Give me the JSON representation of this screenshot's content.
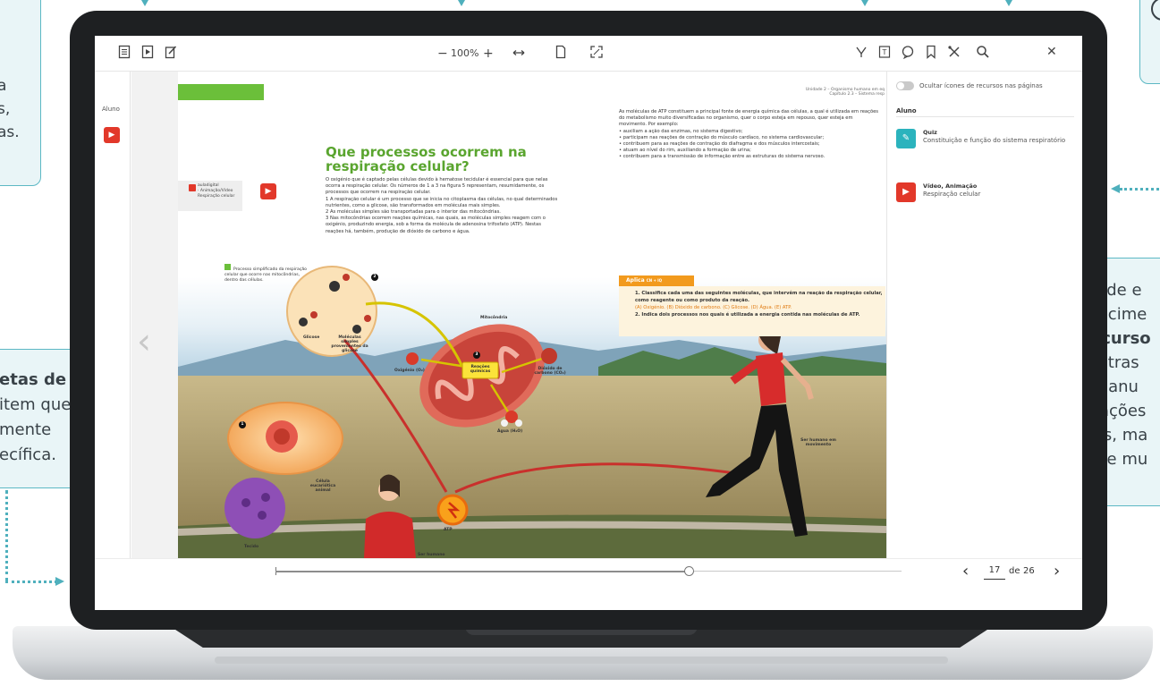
{
  "callouts": {
    "top_left": [
      "a",
      "s,",
      "as."
    ],
    "mid_left": [
      "etas de",
      "item que",
      "mente",
      "ecífica."
    ],
    "mid_left_bold_line": "etas de",
    "right": [
      "Aprende e",
      "conhecime",
      "os recurso",
      "encontras",
      "dos manu",
      "animações",
      "áudios, ma",
      "jogos e mu"
    ],
    "right_bold_word": "recurso"
  },
  "toolbar": {
    "zoom_minus": "−",
    "zoom_value": "100%",
    "zoom_plus": "+",
    "close": "✕"
  },
  "rail": {
    "label": "Aluno"
  },
  "page_content": {
    "left_title": "Que processos ocorrem na respiração celular?",
    "left_body": [
      "O oxigénio que é captado pelas células devido à hematose tecidular é essencial para que nelas ocorra a respiração celular. Os números de 1 a 3 na figura 5 representam, resumidamente, os processos que ocorrem na respiração celular.",
      "1  A respiração celular é um processo que se inicia no citoplasma das células, no qual determinados nutrientes, como a glicose, são transformados em moléculas mais simples.",
      "2  As moléculas simples são transportadas para o interior das mitocôndrias.",
      "3  Nas mitocôndrias ocorrem reações químicas, nas quais, as moléculas simples reagem com o oxigénio, produzindo energia, sob a forma da molécula de adenosina trifosfato (ATP). Nestas reações há, também, produção de dióxido de carbono e água."
    ],
    "side_card_lines": [
      "auladigital",
      "· Animação/Vídeo",
      "Respiração celular"
    ],
    "caption": "Processo simplificado da respiração celular que ocorre nas mitocôndrias, dentro das células.",
    "header_right": [
      "Unidade 2 – Organismo humano em eq",
      "Capítulo 2.3 – Sistema resp"
    ],
    "right_body": [
      "As moléculas de ATP constituem a principal fonte de energia química das células, a qual é utilizada em reações do metabolismo muito diversificadas no organismo, quer o corpo esteja em repouso, quer esteja em movimento. Por exemplo:",
      "• auxiliam a ação das enzimas, no sistema digestivo;",
      "• participam nas reações de contração do músculo cardíaco, no sistema cardiovascular;",
      "• contribuem para as reações de contração do diafragma e dos músculos intercostais;",
      "• atuam ao nível do rim, auxiliando a formação de urina;",
      "• contribuem para a transmissão de informação entre as estruturas do sistema nervoso."
    ],
    "aplica": "Aplica",
    "cm_label": "CN + IQ",
    "question_1": "1.  Classifica cada uma das seguintes moléculas, que intervêm na reação da respiração celular, como reagente ou como produto da reação.",
    "question_options": "(A) Oxigénio.   (B) Dióxido de carbono.   (C) Glicose.   (D) Água.   (E) ATP.",
    "question_2": "2.  Indica dois processos nos quais é utilizada a energia contida nas moléculas de ATP.",
    "labels": {
      "mitocondria": "Mitocôndria",
      "oxigenio": "Oxigénio (O₂)",
      "reacoes": "Reações químicas",
      "dioxido": "Dióxido de carbono (CO₂)",
      "agua": "Água (H₂O)",
      "glicose": "Glicose",
      "moleculas": "Moléculas simples provenientes da glicose",
      "celula": "Célula eucariótica animal",
      "tecido": "Tecido",
      "atp": "ATP",
      "ser_humano_1": "Ser humano",
      "ser_humano_2": "Ser humano em movimento",
      "n1": "1",
      "n2": "2",
      "n3": "3"
    }
  },
  "panel": {
    "toggle_label": "Ocultar ícones de recursos nas páginas",
    "section": "Aluno",
    "resources": [
      {
        "type": "Quiz",
        "title": "Constituição e função do sistema respiratório",
        "color": "#2bb3bd",
        "icon": "pencil-icon"
      },
      {
        "type": "Vídeo, Animação",
        "title": "Respiração celular",
        "color": "#e2382a",
        "icon": "play-icon"
      }
    ]
  },
  "pagination": {
    "current": "17",
    "separator": "de",
    "total": "26",
    "progress": 0.66
  }
}
